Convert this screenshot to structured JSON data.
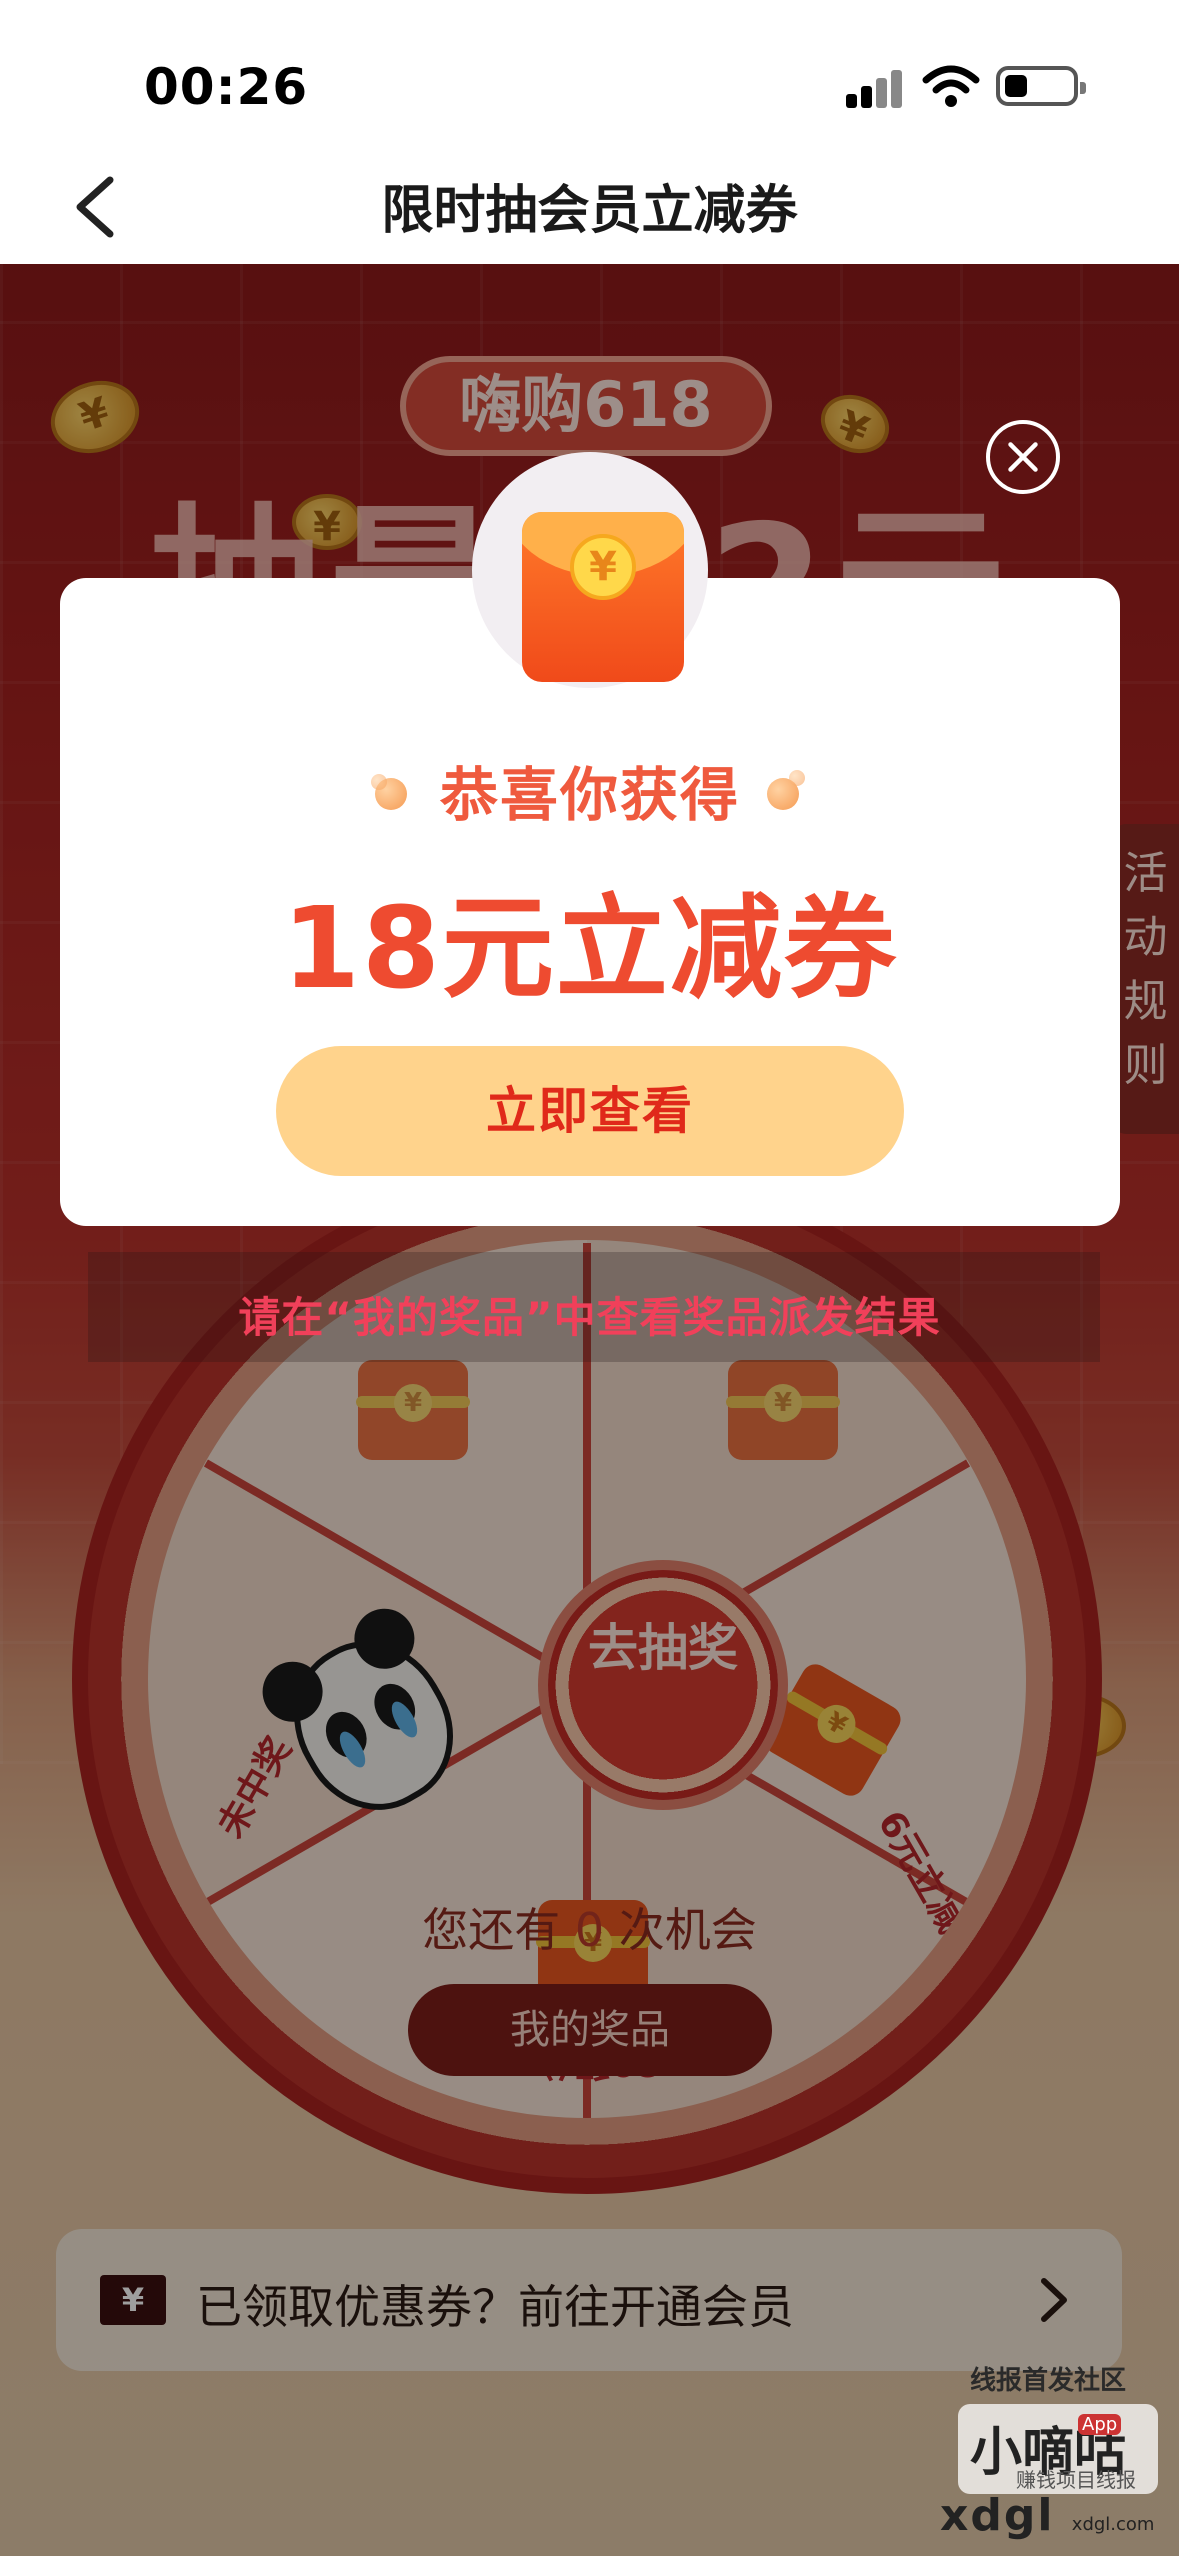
{
  "status_bar": {
    "time": "00:26",
    "icons": [
      "cellular-signal-icon",
      "wifi-icon",
      "battery-icon"
    ]
  },
  "nav": {
    "back_icon": "chevron-left-icon",
    "title": "限时抽会员立减券"
  },
  "activity": {
    "event_badge": "嗨购618",
    "headline_visible": "抽最  62元",
    "rules_tab": [
      "活",
      "动",
      "规",
      "则"
    ],
    "wheel": {
      "center_label": "去抽奖",
      "prizes": [
        {
          "label": "未中奖",
          "icon": "sad-face-icon"
        },
        {
          "label": "6元立减券",
          "icon": "red-packet-icon"
        },
        {
          "label": "89积分",
          "icon": "red-packet-icon"
        }
      ]
    },
    "chances_prefix": "您还有",
    "chances_count": "0",
    "chances_suffix": "次机会",
    "my_prizes_button": "我的奖品",
    "member_bar": {
      "icon": "coupon-ticket-icon",
      "text": "已领取优惠券？前往开通会员",
      "chevron_icon": "chevron-right-icon"
    }
  },
  "modal": {
    "icon": "red-envelope-icon",
    "title": "恭喜你获得",
    "prize": "18元立减券",
    "primary_button": "立即查看",
    "close_icon": "close-circle-icon"
  },
  "result_notice": "请在“我的奖品”中查看奖品派发结果",
  "watermark": {
    "line1": "线报首发社区",
    "logo": "小嘀咕",
    "app_tag": "App",
    "sub": "赚钱项目线报",
    "site": "xdgl",
    "site_small": "xdgl.com"
  },
  "colors": {
    "accent_red": "#ee4b30",
    "button_yellow": "#ffd38c",
    "notice_pink": "#f1405a",
    "activity_red": "#a3211f"
  }
}
